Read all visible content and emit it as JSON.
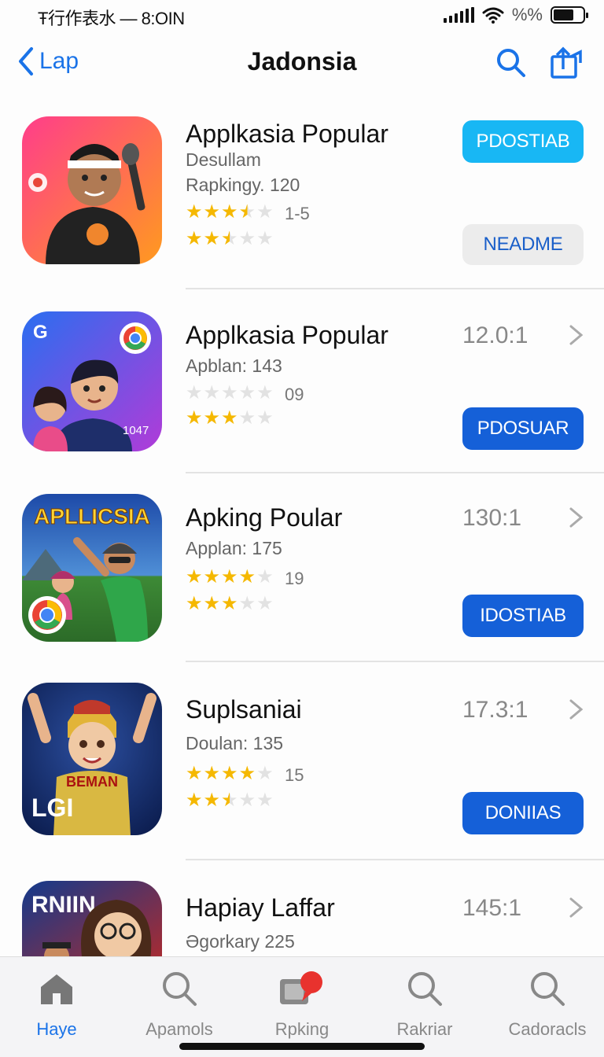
{
  "status_bar": {
    "time": "Ŧ行作表水 — 8:OIN",
    "battery_text": "%%",
    "battery_level": 0.7
  },
  "nav": {
    "back_label": "Lap",
    "title": "Jadonsia"
  },
  "apps": [
    {
      "name": "Applkasia Popular",
      "line1": "Desullam",
      "line2": "Rapkingy. 120",
      "rating1": 3.5,
      "rating1_count": "1-5",
      "rating2": 2.5,
      "score": "",
      "primary_button": "PDOSTIAB",
      "secondary_button": "NEADME",
      "icon_bg": [
        "#ff3d8b",
        "#ff9a1f"
      ],
      "icon_label": ""
    },
    {
      "name": "Applkasia Popular",
      "line1": "Apblan: 143",
      "line2": "",
      "rating1": 0,
      "rating1_count": "09",
      "rating2": 3,
      "score": "12.0:1",
      "primary_button": "PDOSUAR",
      "icon_bg": [
        "#2a6ef0",
        "#b13bd8"
      ],
      "icon_label": "G",
      "icon_badge": "1047"
    },
    {
      "name": "Apking Poular",
      "line1": "Applan: 175",
      "line2": "",
      "rating1": 4,
      "rating1_count": "19",
      "rating2": 3,
      "score": "130:1",
      "primary_button": "IDOSTIAB",
      "icon_bg": [
        "#1d4aa8",
        "#3d8a36"
      ],
      "icon_label": "APLLICSIA"
    },
    {
      "name": "Suplsaniai",
      "line1": "Doulan: 135",
      "line2": "",
      "rating1": 4,
      "rating1_count": "15",
      "rating2": 2.5,
      "score": "17.3:1",
      "primary_button": "DONIIAS",
      "icon_bg": [
        "#0d2a6e",
        "#c23b2b"
      ],
      "icon_label": "LGI",
      "icon_shirt": "BEMAN"
    },
    {
      "name": "Hapiay Laffar",
      "line1": "Əgorkary 225",
      "line2": "",
      "score": "145:1",
      "icon_bg": [
        "#123a8c",
        "#b52a2a"
      ],
      "icon_label": "RNIIN"
    }
  ],
  "tabs": [
    {
      "label": "Haye",
      "icon": "home-icon",
      "active": true
    },
    {
      "label": "Apamols",
      "icon": "search-icon",
      "active": false
    },
    {
      "label": "Rpking",
      "icon": "ranking-icon",
      "active": false
    },
    {
      "label": "Rakriar",
      "icon": "search-icon",
      "active": false
    },
    {
      "label": "Cadoracls",
      "icon": "search-icon",
      "active": false
    }
  ],
  "colors": {
    "accent": "#1a73e8",
    "button_primary": "#1560d8",
    "button_cyan": "#18b7f4",
    "star": "#f5b800"
  }
}
